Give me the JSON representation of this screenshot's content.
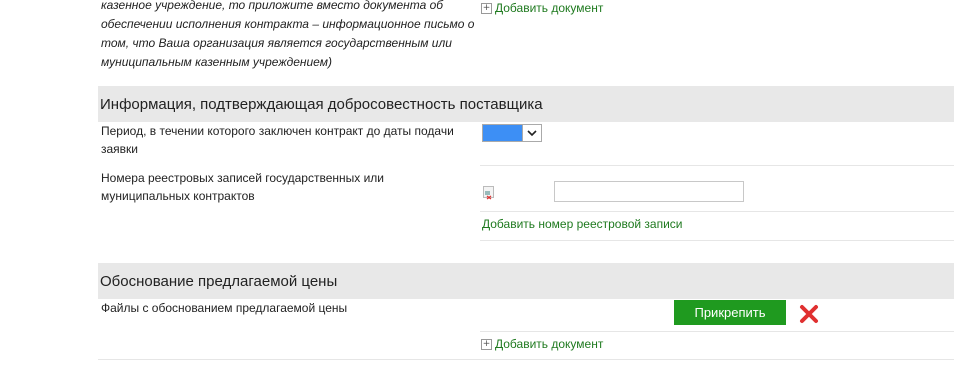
{
  "top": {
    "italic_text": "казенное учреждение, то приложите вместо документа об обеспечении исполнения контракта – информационное письмо о том, что Ваша организация является государственным или муниципальным казенным учреждением)",
    "add_document": "Добавить документ"
  },
  "section_reliability": {
    "title": "Информация, подтверждающая добросовестность поставщика",
    "period_label": "Период, в течении которого заключен контракт до даты подачи заявки",
    "registry_label": "Номера реестровых записей государственных или муниципальных контрактов",
    "registry_input_value": "",
    "add_registry_link": "Добавить номер реестровой записи"
  },
  "section_price": {
    "title": "Обоснование предлагаемой цены",
    "files_label": "Файлы с обоснованием предлагаемой цены",
    "attach_button": "Прикрепить",
    "add_document": "Добавить документ"
  },
  "colors": {
    "link": "#1f7a1f",
    "button": "#1f9a1f",
    "header_bg": "#e8e8e8",
    "remove": "#e03030"
  }
}
